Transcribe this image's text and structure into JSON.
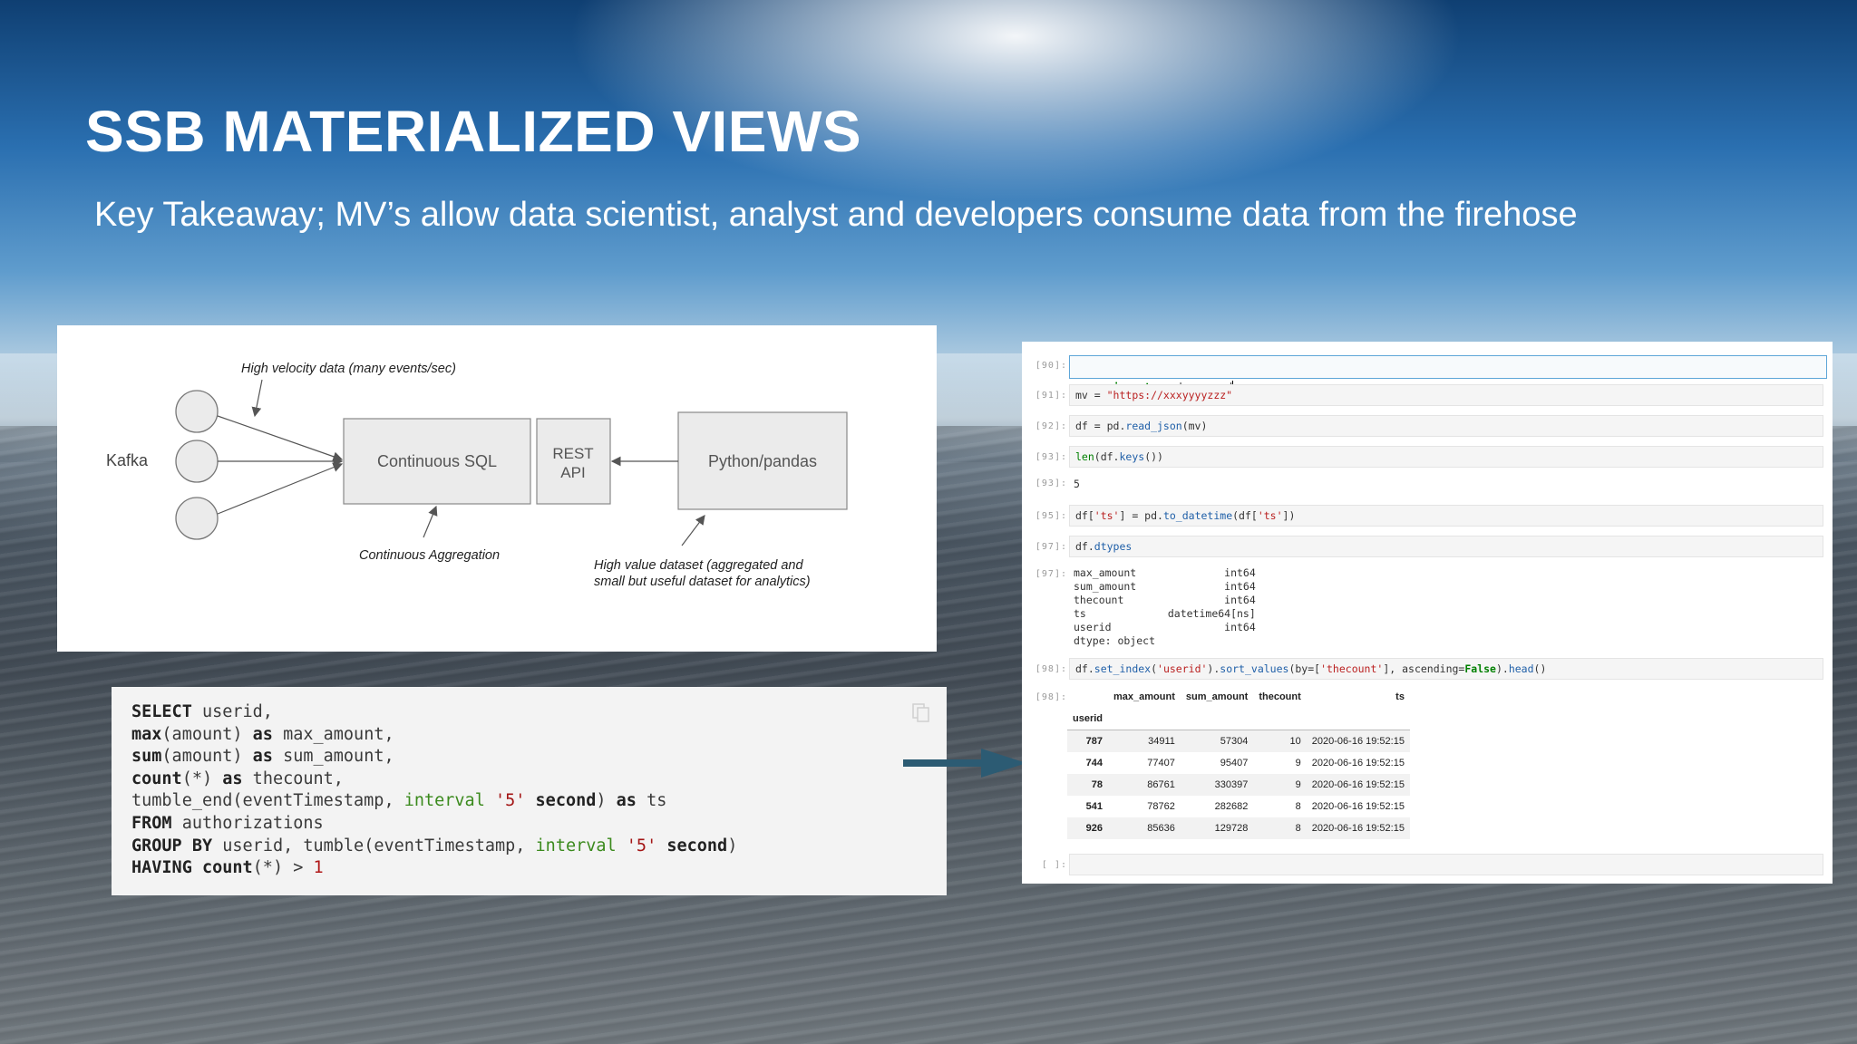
{
  "slide": {
    "title": "SSB MATERIALIZED VIEWS",
    "subtitle": "Key Takeaway; MV’s allow data scientist, analyst and developers consume data from the firehose"
  },
  "diagram": {
    "kafka_label": "Kafka",
    "continuous_sql": "Continuous SQL",
    "rest_line1": "REST",
    "rest_line2": "API",
    "python_pandas": "Python/pandas",
    "high_velocity": "High velocity data (many events/sec)",
    "continuous_aggregation": "Continuous Aggregation",
    "high_value_line1": "High value dataset (aggregated and",
    "high_value_line2": "small but useful dataset for analytics)"
  },
  "sql": {
    "lines": [
      "SELECT userid,",
      "max(amount) as max_amount,",
      "sum(amount) as sum_amount,",
      "count(*) as thecount,",
      "tumble_end(eventTimestamp, interval '5' second) as ts",
      "FROM authorizations",
      "GROUP BY userid, tumble(eventTimestamp, interval '5' second)",
      "HAVING count(*) > 1"
    ]
  },
  "notebook": {
    "cells": [
      {
        "prompt": "[90]:",
        "code": "import pandas as pd"
      },
      {
        "prompt": "[91]:",
        "code": "mv = \"https://xxxyyyyzzz\""
      },
      {
        "prompt": "[92]:",
        "code": "df = pd.read_json(mv)"
      },
      {
        "prompt": "[93]:",
        "code": "len(df.keys())"
      },
      {
        "prompt": "[93]:",
        "output": "5"
      },
      {
        "prompt": "[95]:",
        "code": "df['ts'] = pd.to_datetime(df['ts'])"
      },
      {
        "prompt": "[97]:",
        "code": "df.dtypes"
      },
      {
        "prompt": "[97]:",
        "output": "max_amount              int64\nsum_amount              int64\nthecount                int64\nts             datetime64[ns]\nuserid                  int64\ndtype: object"
      },
      {
        "prompt": "[98]:",
        "code": "df.set_index('userid').sort_values(by=['thecount'], ascending=False).head()"
      },
      {
        "prompt": "[98]:",
        "output": ""
      },
      {
        "prompt": "[ ]:",
        "code": ""
      }
    ],
    "dataframe": {
      "columns": [
        "max_amount",
        "sum_amount",
        "thecount",
        "ts"
      ],
      "index_name": "userid",
      "rows": [
        {
          "userid": "787",
          "max_amount": "34911",
          "sum_amount": "57304",
          "thecount": "10",
          "ts": "2020-06-16 19:52:15"
        },
        {
          "userid": "744",
          "max_amount": "77407",
          "sum_amount": "95407",
          "thecount": "9",
          "ts": "2020-06-16 19:52:15"
        },
        {
          "userid": "78",
          "max_amount": "86761",
          "sum_amount": "330397",
          "thecount": "9",
          "ts": "2020-06-16 19:52:15"
        },
        {
          "userid": "541",
          "max_amount": "78762",
          "sum_amount": "282682",
          "thecount": "8",
          "ts": "2020-06-16 19:52:15"
        },
        {
          "userid": "926",
          "max_amount": "85636",
          "sum_amount": "129728",
          "thecount": "8",
          "ts": "2020-06-16 19:52:15"
        }
      ]
    }
  }
}
